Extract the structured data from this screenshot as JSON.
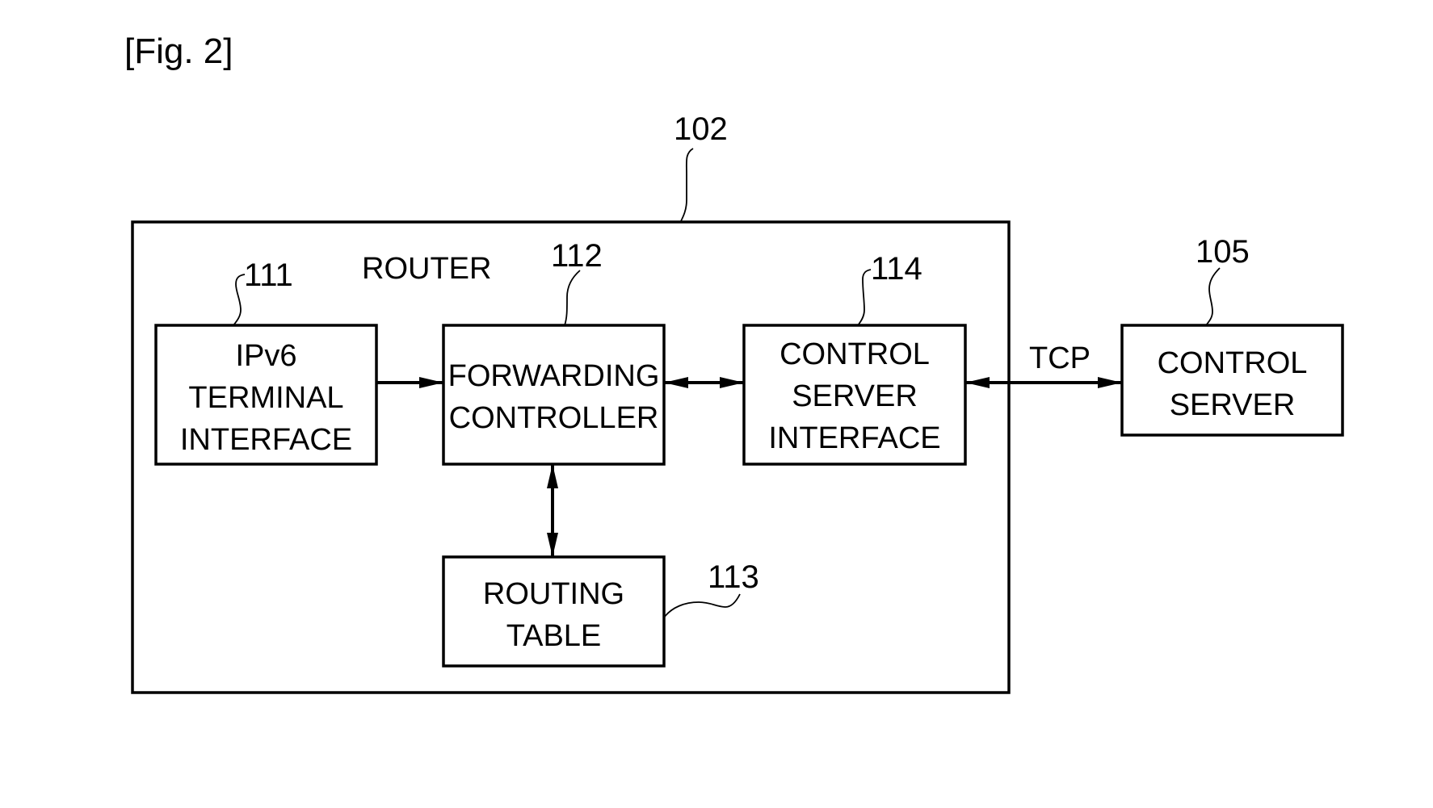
{
  "figure": {
    "label": "[Fig. 2]"
  },
  "router": {
    "ref": "102",
    "title": "ROUTER"
  },
  "blocks": {
    "ipv6_terminal_interface": {
      "ref": "111",
      "lines": [
        "IPv6",
        "TERMINAL",
        "INTERFACE"
      ]
    },
    "forwarding_controller": {
      "ref": "112",
      "lines": [
        "FORWARDING",
        "CONTROLLER"
      ]
    },
    "routing_table": {
      "ref": "113",
      "lines": [
        "ROUTING",
        "TABLE"
      ]
    },
    "control_server_interface": {
      "ref": "114",
      "lines": [
        "CONTROL",
        "SERVER",
        "INTERFACE"
      ]
    },
    "control_server": {
      "ref": "105",
      "lines": [
        "CONTROL",
        "SERVER"
      ]
    }
  },
  "connections": [
    {
      "from": "IPv6 TERMINAL INTERFACE",
      "to": "FORWARDING CONTROLLER",
      "direction": "one-way"
    },
    {
      "from": "FORWARDING CONTROLLER",
      "to": "CONTROL SERVER INTERFACE",
      "direction": "bidirectional"
    },
    {
      "from": "FORWARDING CONTROLLER",
      "to": "ROUTING TABLE",
      "direction": "bidirectional"
    },
    {
      "from": "CONTROL SERVER INTERFACE",
      "to": "CONTROL SERVER",
      "direction": "bidirectional",
      "label": "TCP"
    }
  ]
}
